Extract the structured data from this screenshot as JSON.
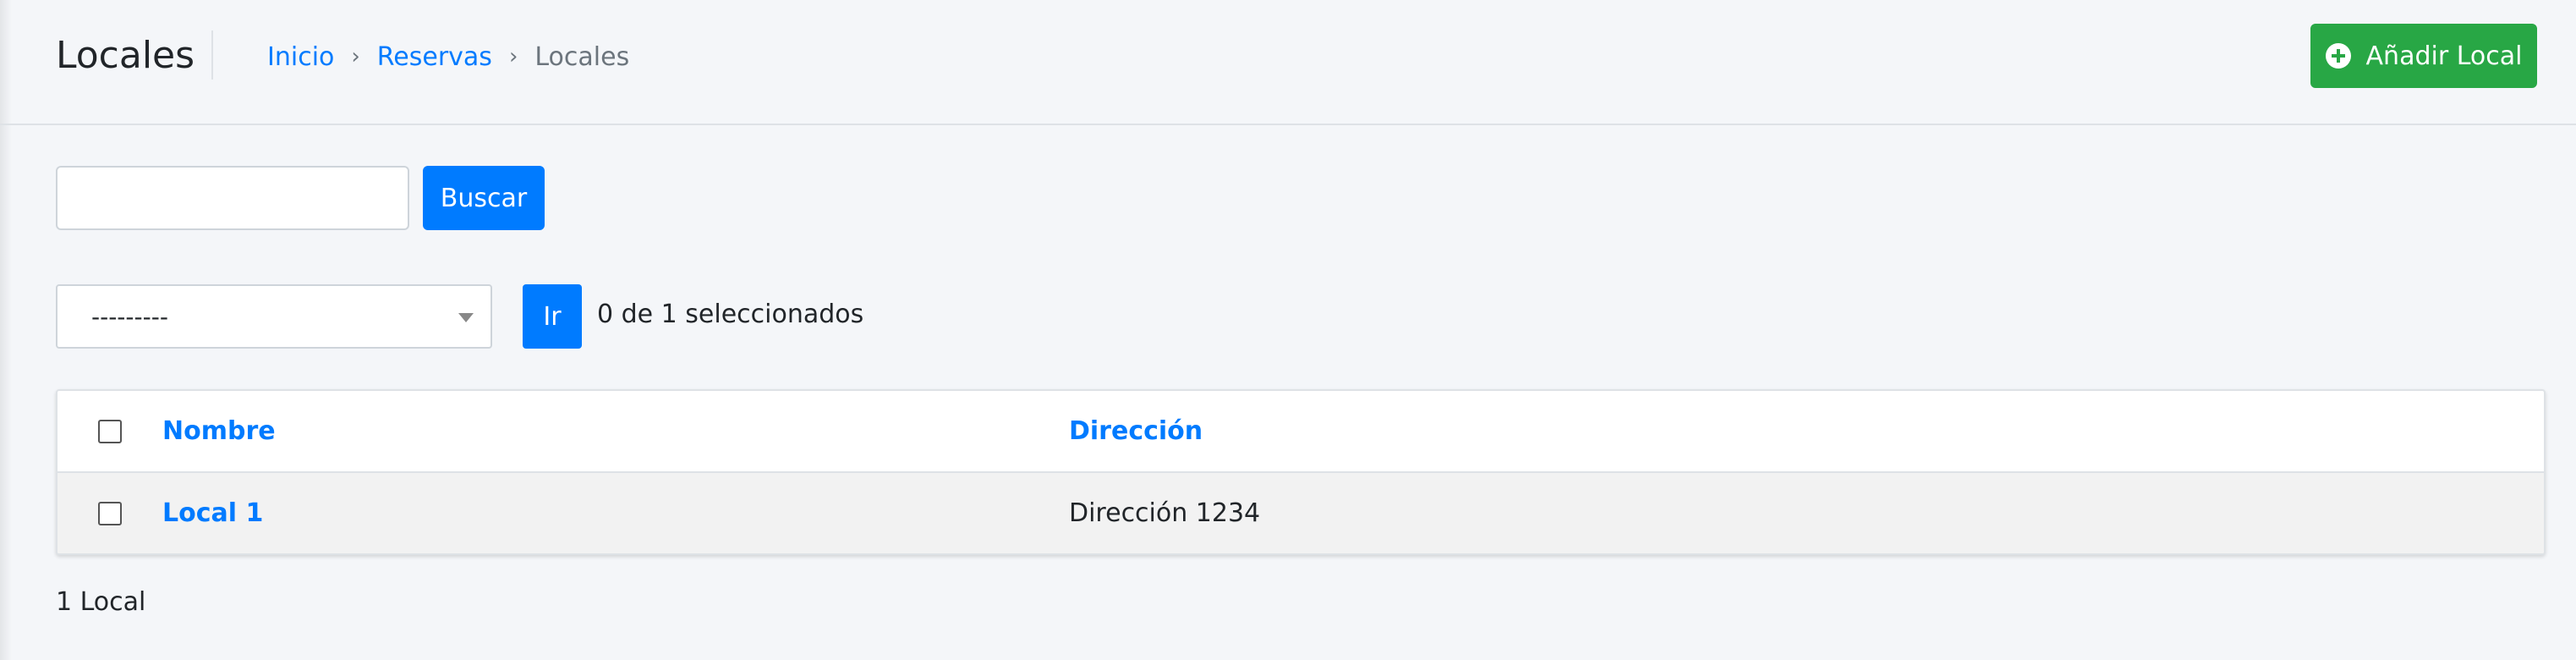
{
  "header": {
    "title": "Locales",
    "breadcrumb": {
      "items": [
        "Inicio",
        "Reservas"
      ],
      "separator": "›",
      "current": "Locales"
    },
    "add_button_label": "Añadir Local"
  },
  "search": {
    "value": "",
    "button_label": "Buscar"
  },
  "actions": {
    "selected_option": "---------",
    "go_label": "Ir",
    "selection_counter": "0 de 1 seleccionados"
  },
  "table": {
    "columns": [
      "Nombre",
      "Dirección"
    ],
    "rows": [
      {
        "nombre": "Local 1",
        "direccion": "Dirección 1234"
      }
    ]
  },
  "footer": {
    "results_count": "1 Local"
  },
  "colors": {
    "primary": "#007bff",
    "success": "#28a745",
    "background": "#f4f6f9"
  },
  "icons": {
    "add_button": "plus-circle-icon",
    "select": "caret-down-icon"
  }
}
